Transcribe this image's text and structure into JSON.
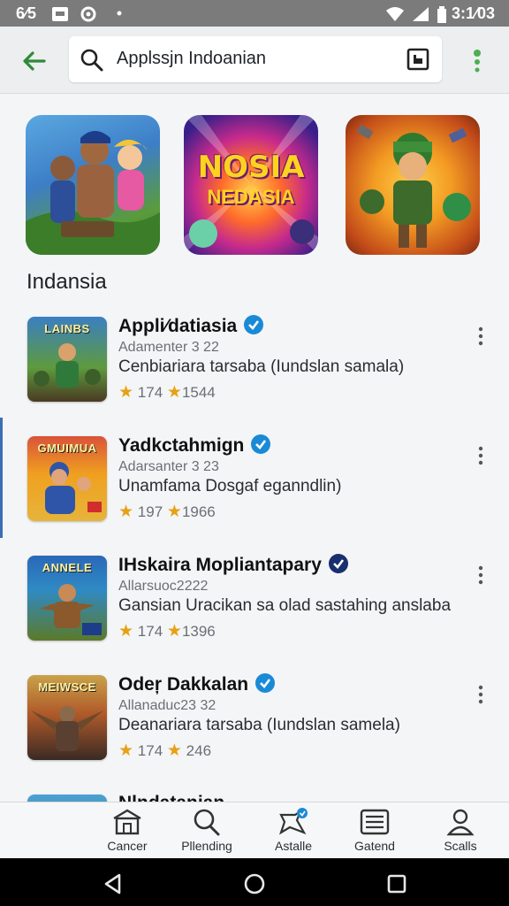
{
  "status_bar": {
    "time": "6⁄5",
    "clock": "3:1⁄03"
  },
  "search": {
    "query": "Applssjn Indoanian"
  },
  "featured": [
    {
      "title": "NOSIA",
      "subtitle": "NEDASIA"
    }
  ],
  "section_title": "Indansia",
  "apps": [
    {
      "name": "Appli⁄datiasia",
      "developer": "Adamenter 3 22",
      "description": "Cenbiariara tarsaba (Iundslan samala)",
      "rating": "174",
      "downloads": "1544",
      "icon_label": "LAINBS"
    },
    {
      "name": "Yadkctahmign",
      "developer": "Adarsanter 3 23",
      "description": "Unamfama Dosgaf eganndlin)",
      "rating": "197",
      "downloads": "1966",
      "icon_label": "GMUIMUA"
    },
    {
      "name": "IHskaira Mopliantapary",
      "developer": "Allarsuoc2222",
      "description": "Gansian Uracikan sa olad sastahing anslaba",
      "rating": "174",
      "downloads": "1396",
      "icon_label": "ANNELE"
    },
    {
      "name": "Odeŗ Dakkalan",
      "developer": "Allanaduc23 32",
      "description": "Deanariara tarsaba (Iundslan samela)",
      "rating": "174",
      "downloads": "246",
      "icon_label": "MEIWSCE"
    },
    {
      "name": "Nlndatanian",
      "developer": "",
      "description": "",
      "rating": "",
      "downloads": "",
      "icon_label": ""
    }
  ],
  "bottom_nav": [
    {
      "label": "Cancer",
      "icon": "store-icon"
    },
    {
      "label": "Pllending",
      "icon": "search-icon"
    },
    {
      "label": "Astalle",
      "icon": "badge-icon"
    },
    {
      "label": "Gatend",
      "icon": "list-icon"
    },
    {
      "label": "Scalls",
      "icon": "account-icon"
    }
  ],
  "colors": {
    "accent_green": "#2e8b3a",
    "verified_blue": "#1a8ad6",
    "verified_navy": "#1a2f6e",
    "star": "#e7a114"
  }
}
